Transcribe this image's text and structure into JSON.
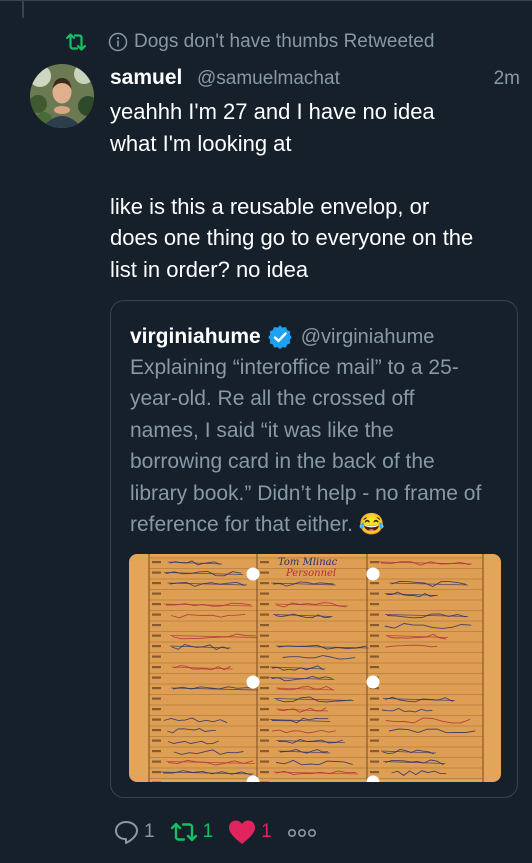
{
  "retweet_context": {
    "text": "Dogs don't have thumbs Retweeted",
    "icons": [
      "retweet-icon",
      "info-icon"
    ]
  },
  "tweet": {
    "author": {
      "name": "samuel",
      "handle": "@samuelmachat"
    },
    "time": "2m",
    "text": {
      "para1_line1": "yeahhh I'm 27 and I have no idea",
      "para1_line2": "what I'm looking at",
      "para2_line1": "like is this a reusable envelop, or",
      "para2_line2": "does one thing go to everyone on the",
      "para2_line3": "list in order? no idea"
    }
  },
  "quoted_tweet": {
    "author": {
      "name": "virginiahume",
      "handle": "@virginiahume",
      "verified": true
    },
    "text_lines": [
      "Explaining “interoffice mail” to a 25-",
      "year-old. Re all the crossed off",
      "names, I said “it was like the",
      "borrowing card in the back of the",
      "library book.” Didn’t help - no frame of",
      "reference for that either. 😂"
    ]
  },
  "image_card": {
    "columns": [
      {
        "rows": [
          "",
          "",
          "",
          "",
          "",
          "",
          "",
          "",
          "",
          "",
          ""
        ]
      },
      {
        "rows": [
          "Tom Mlinac",
          "Personnel",
          "",
          "",
          "",
          "",
          "",
          "",
          "",
          "",
          ""
        ]
      },
      {
        "rows": [
          "",
          "",
          "",
          "",
          "",
          "",
          "",
          "",
          "",
          "",
          ""
        ]
      }
    ],
    "colors": {
      "paper": "#e2a55a",
      "lines": "#8a5a2a",
      "ink_blue": "#28306a",
      "ink_red": "#b0303a"
    }
  },
  "actions": {
    "reply_count": "1",
    "retweet_count": "1",
    "like_count": "1",
    "icons": [
      "reply-icon",
      "retweet-icon",
      "like-icon",
      "more-icon"
    ]
  },
  "colors": {
    "background": "#15202b",
    "text_primary": "#ffffff",
    "text_secondary": "#8899a6",
    "border": "#38444d",
    "retweet_green": "#17bf63",
    "like_red": "#e0245e",
    "verified_blue": "#1da1f2"
  }
}
